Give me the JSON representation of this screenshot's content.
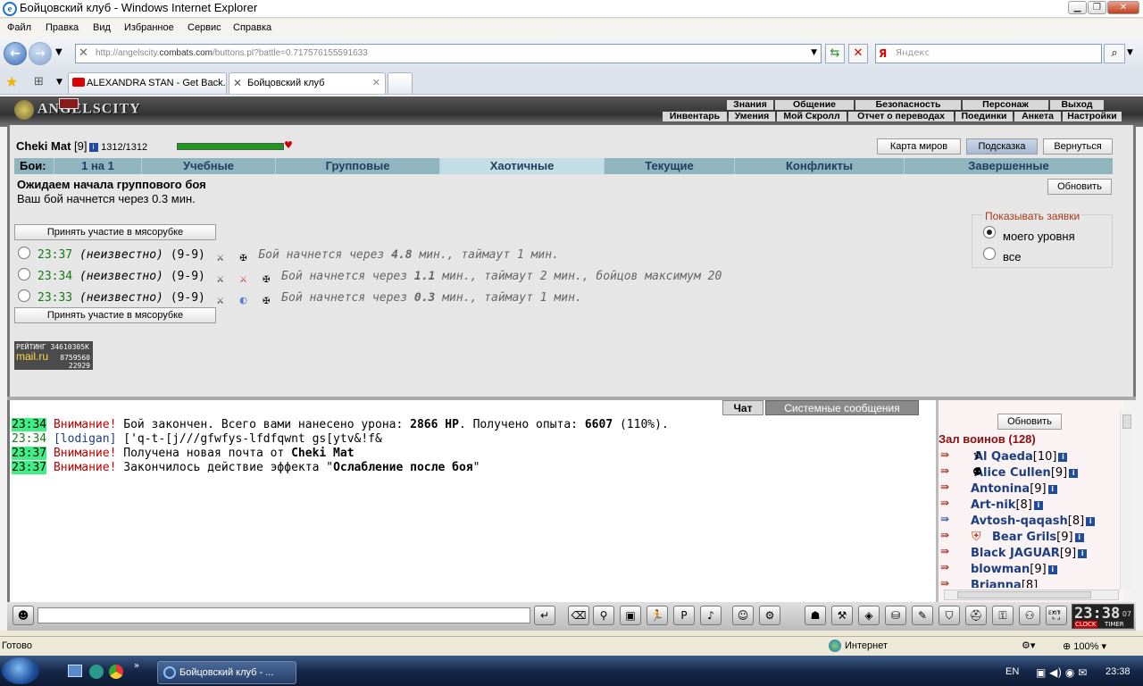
{
  "window": {
    "title": "Бойцовский клуб - Windows Internet Explorer"
  },
  "menu": [
    "Файл",
    "Правка",
    "Вид",
    "Избранное",
    "Сервис",
    "Справка"
  ],
  "address": {
    "host_pre": "http://angelscity.",
    "host_main": "combats.com",
    "path": "/buttons.pl?battle=0.717576155591633"
  },
  "search": {
    "placeholder": "Яндекс"
  },
  "tabs": [
    {
      "label": "ALEXANDRA STAN - Get Back..."
    },
    {
      "label": "Бойцовский клуб"
    }
  ],
  "game": {
    "logo": "ANGELSCITY",
    "top_menu": [
      "Знания",
      "Общение",
      "Безопасность",
      "Персонаж",
      "Выход"
    ],
    "sub_menu": [
      "Инвентарь",
      "Умения",
      "Мой Скролл",
      "Отчет о переводах",
      "Поединки",
      "Анкета",
      "Настройки"
    ]
  },
  "player": {
    "name": "Cheki Mat",
    "level": "[9]",
    "hp": "1312/1312"
  },
  "top_buttons": [
    "Карта миров",
    "Подсказка",
    "Вернуться"
  ],
  "fight_tabs": {
    "label": "Бои:",
    "items": [
      "1 на 1",
      "Учебные",
      "Групповые",
      "Хаотичные",
      "Текущие",
      "Конфликты",
      "Завершенные"
    ]
  },
  "status": {
    "heading": "Ожидаем начала группового боя",
    "sub": "Ваш бой начнется через 0.3 мин."
  },
  "refresh_label": "Обновить",
  "join_label": "Принять участие в мясорубке",
  "fights": [
    {
      "time": "23:37",
      "who": "(неизвестно)",
      "lv": "(9-9)",
      "pre": "Бой начнется через ",
      "mins": "4.8",
      "post": " мин., таймаут 1 мин."
    },
    {
      "time": "23:34",
      "who": "(неизвестно)",
      "lv": "(9-9)",
      "pre": "Бой начнется через ",
      "mins": "1.1",
      "post": " мин., таймаут 2 мин., бойцов максимум 20"
    },
    {
      "time": "23:33",
      "who": "(неизвестно)",
      "lv": "(9-9)",
      "pre": "Бой начнется через ",
      "mins": "0.3",
      "post": " мин., таймаут 1 мин."
    }
  ],
  "filter": {
    "title": "Показывать заявки",
    "options": [
      "моего уровня",
      "все"
    ],
    "selected": "моего уровня"
  },
  "rating_badge": {
    "l1": "РЕЙТИНГ 3461",
    "l1b": "0305К",
    "l2": "mail.ru",
    "n1": "8759560",
    "n2": "22929"
  },
  "chat_tabs": [
    "Чат",
    "Системные сообщения"
  ],
  "chat": [
    {
      "time": "23:34",
      "hl": true,
      "warn": "Внимание!",
      "text": " Бой закончен. Всего вами нанесено урона: ",
      "b1": "2866 HP",
      "text2": ". Получено опыта: ",
      "b2": "6607",
      "text3": " (110%)."
    },
    {
      "time": "23:34",
      "hl": false,
      "nick": "[lodigan]",
      "text": " ['q-t-[j///gfwfys-lfdfqwnt gs[ytv&!f&"
    },
    {
      "time": "23:37",
      "hl": true,
      "warn": "Внимание!",
      "text": " Получена новая почта от ",
      "b1": "Cheki Mat"
    },
    {
      "time": "23:37",
      "hl": true,
      "warn": "Внимание!",
      "text": " Закончилось действие эффекта \"",
      "b1": "Ослабление после боя",
      "text2": "\""
    }
  ],
  "hall": {
    "refresh": "Обновить",
    "title": "Зал воинов (128)",
    "players": [
      {
        "name": "Al Qaeda",
        "lv": "[10]",
        "clan": true
      },
      {
        "name": "Alice Cullen",
        "lv": "[9]",
        "clan": true
      },
      {
        "name": "Antonina",
        "lv": "[9]",
        "clan": false
      },
      {
        "name": "Art-nik",
        "lv": "[8]",
        "clan": false
      },
      {
        "name": "Avtosh-qaqash",
        "lv": "[8]",
        "clan": false
      },
      {
        "name": "Bear Grils",
        "lv": "[9]",
        "clan": true
      },
      {
        "name": "Black JAGUAR",
        "lv": "[9]",
        "clan": false
      },
      {
        "name": "blowman",
        "lv": "[9]",
        "clan": false
      },
      {
        "name": "Brianna",
        "lv": "[8]",
        "clan": false
      }
    ]
  },
  "clock": {
    "time": "23:38",
    "sec": "07",
    "label1": "CLOCK",
    "label2": "TIMER",
    "exit": "EXIT"
  },
  "statusbar": {
    "left": "Готово",
    "zone": "Интернет",
    "zoom": "100%"
  },
  "taskbar": {
    "task": "Бойцовский клуб - ...",
    "lang": "EN",
    "time": "23:38"
  }
}
